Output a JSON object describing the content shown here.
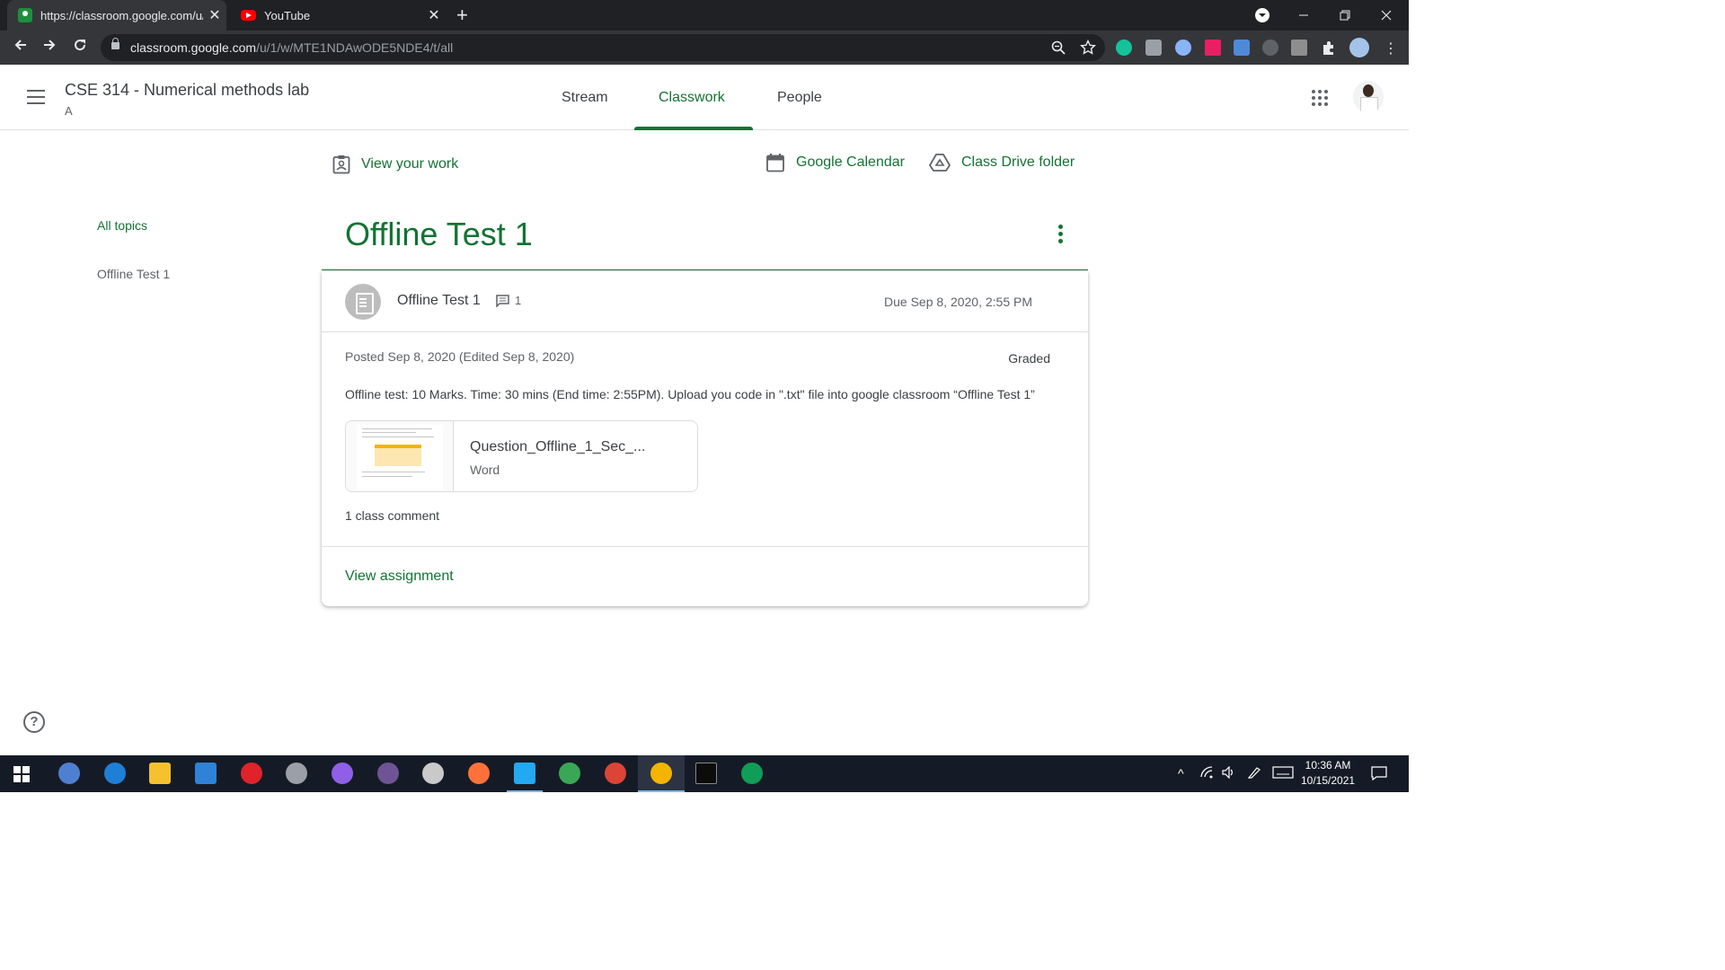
{
  "browser": {
    "tabs": [
      {
        "title": "https://classroom.google.com/u/",
        "active": true
      },
      {
        "title": "YouTube",
        "active": false
      }
    ],
    "url_host": "classroom.google.com",
    "url_path": "/u/1/w/MTE1NDAwODE5NDE4/t/all"
  },
  "header": {
    "class_title": "CSE 314 - Numerical methods lab",
    "class_section": "A",
    "nav_tabs": [
      {
        "label": "Stream",
        "active": false
      },
      {
        "label": "Classwork",
        "active": true
      },
      {
        "label": "People",
        "active": false
      }
    ]
  },
  "toolbar": {
    "view_work": "View your work",
    "calendar": "Google Calendar",
    "drive": "Class Drive folder"
  },
  "sidebar": {
    "all_topics": "All topics",
    "topics": [
      "Offline Test 1"
    ]
  },
  "topic": {
    "title": "Offline Test 1",
    "assignment": {
      "title": "Offline Test 1",
      "comment_count": "1",
      "due": "Due Sep 8, 2020, 2:55 PM",
      "posted": "Posted Sep 8, 2020 (Edited Sep 8, 2020)",
      "status": "Graded",
      "description": "Offline test: 10 Marks. Time: 30 mins (End time: 2:55PM). Upload you code in \".txt\" file into google classroom “Offline Test 1”",
      "attachment": {
        "name": "Question_Offline_1_Sec_...",
        "type": "Word"
      },
      "class_comments": "1 class comment",
      "view_link": "View assignment"
    }
  },
  "taskbar": {
    "time": "10:36 AM",
    "date": "10/15/2021"
  },
  "colors": {
    "accent": "#137333",
    "chrome_dark": "#202124",
    "chrome_toolbar": "#35363a",
    "taskbar": "#151b26"
  },
  "icons": [
    "menu-icon",
    "apps-icon",
    "assignment-icon",
    "comment-icon",
    "calendar-icon",
    "drive-icon",
    "more-vert-icon",
    "help-icon",
    "lock-icon",
    "back-icon",
    "forward-icon",
    "reload-icon",
    "zoom-icon",
    "star-icon",
    "extensions-icon",
    "windows-start-icon"
  ]
}
